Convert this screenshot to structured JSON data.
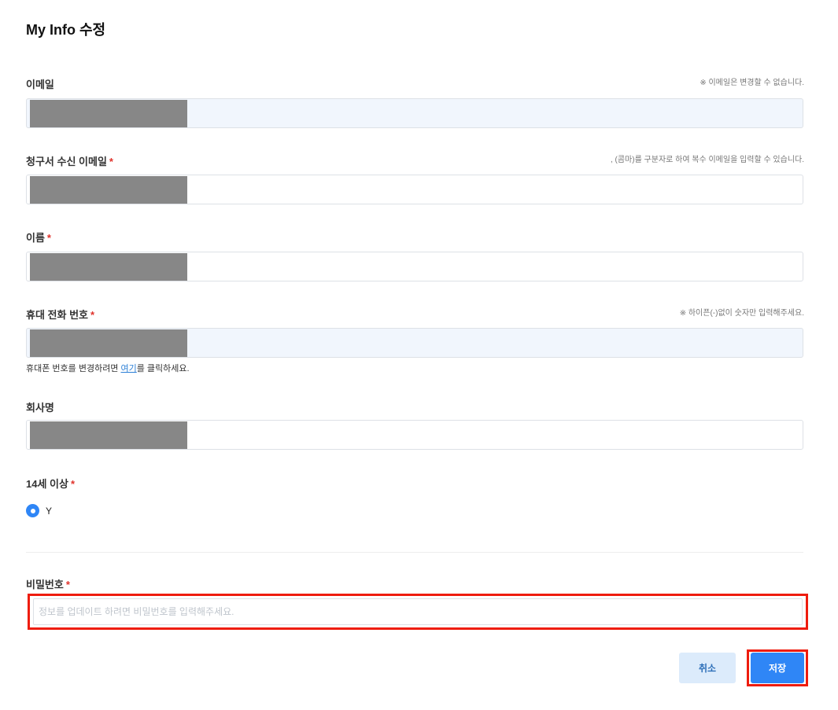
{
  "page": {
    "title": "My Info 수정"
  },
  "fields": {
    "email": {
      "label": "이메일",
      "hint": "※ 이메일은 변경할 수 없습니다."
    },
    "billing_email": {
      "label": "청구서 수신 이메일",
      "required": "*",
      "hint": ", (콤마)를 구분자로 하여 복수 이메일을 입력할 수 있습니다."
    },
    "name": {
      "label": "이름",
      "required": "*"
    },
    "phone": {
      "label": "휴대 전화 번호",
      "required": "*",
      "hint": "※ 하이픈(-)없이 숫자만 입력해주세요.",
      "note_prefix": "휴대폰 번호를 변경하려면 ",
      "note_link": "여기",
      "note_suffix": "를 클릭하세요."
    },
    "company": {
      "label": "회사명"
    },
    "age14": {
      "label": "14세 이상",
      "required": "*",
      "option_label": "Y",
      "selected": true
    },
    "password": {
      "label": "비밀번호",
      "required": "*",
      "placeholder": "정보를 업데이트 하려면 비밀번호를 입력해주세요.",
      "value": ""
    }
  },
  "buttons": {
    "cancel_label": "취소",
    "save_label": "저장"
  },
  "colors": {
    "accent": "#2f86f6",
    "required": "#e0322b",
    "highlight": "#ee1c0e",
    "masked": "#878787",
    "readonly_bg": "#f1f6fd"
  }
}
